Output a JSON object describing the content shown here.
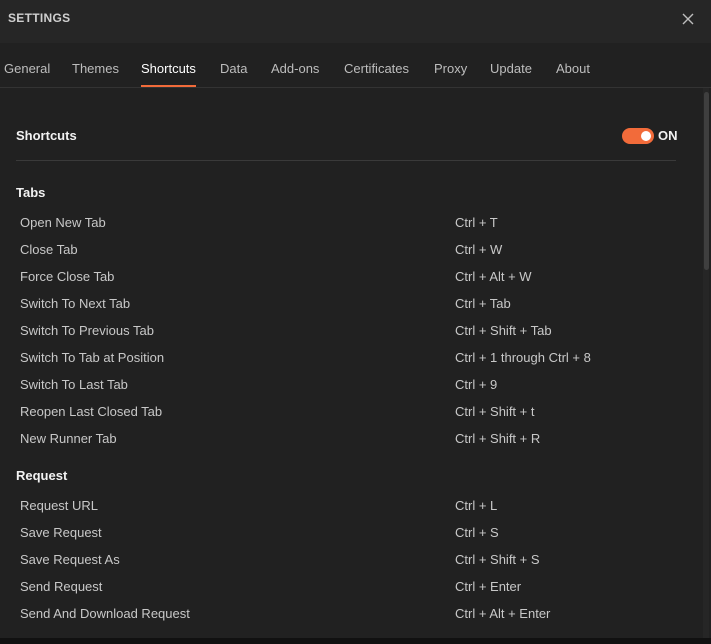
{
  "window": {
    "title": "SETTINGS",
    "close_icon": "close-icon"
  },
  "tabs": [
    {
      "label": "General"
    },
    {
      "label": "Themes"
    },
    {
      "label": "Shortcuts",
      "active": true
    },
    {
      "label": "Data"
    },
    {
      "label": "Add-ons"
    },
    {
      "label": "Certificates"
    },
    {
      "label": "Proxy"
    },
    {
      "label": "Update"
    },
    {
      "label": "About"
    }
  ],
  "shortcuts": {
    "heading": "Shortcuts",
    "toggle_label": "ON",
    "toggle_on": true,
    "accent_color": "#f26b3a"
  },
  "sections": [
    {
      "title": "Tabs",
      "items": [
        {
          "name": "Open New Tab",
          "keys": "Ctrl + T"
        },
        {
          "name": "Close Tab",
          "keys": "Ctrl + W"
        },
        {
          "name": "Force Close Tab",
          "keys": "Ctrl + Alt + W"
        },
        {
          "name": "Switch To Next Tab",
          "keys": "Ctrl + Tab"
        },
        {
          "name": "Switch To Previous Tab",
          "keys": "Ctrl + Shift + Tab"
        },
        {
          "name": "Switch To Tab at Position",
          "keys": "Ctrl + 1 through Ctrl + 8"
        },
        {
          "name": "Switch To Last Tab",
          "keys": "Ctrl + 9"
        },
        {
          "name": "Reopen Last Closed Tab",
          "keys": "Ctrl + Shift + t"
        },
        {
          "name": "New Runner Tab",
          "keys": "Ctrl + Shift + R"
        }
      ]
    },
    {
      "title": "Request",
      "items": [
        {
          "name": "Request URL",
          "keys": "Ctrl + L"
        },
        {
          "name": "Save Request",
          "keys": "Ctrl + S"
        },
        {
          "name": "Save Request As",
          "keys": "Ctrl + Shift + S"
        },
        {
          "name": "Send Request",
          "keys": "Ctrl + Enter"
        },
        {
          "name": "Send And Download Request",
          "keys": "Ctrl + Alt + Enter"
        }
      ]
    }
  ]
}
